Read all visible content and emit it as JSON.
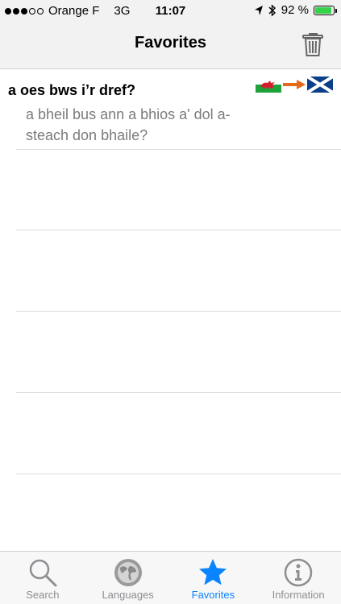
{
  "status_bar": {
    "carrier": "Orange F",
    "network": "3G",
    "time": "11:07",
    "battery_percent": "92 %",
    "battery_level": 0.92,
    "signal_bars": 3
  },
  "nav": {
    "title": "Favorites"
  },
  "favorites": [
    {
      "phrase": "a oes bws i’r dref?",
      "translation": "a bheil bus ann a bhios a' dol a-steach don bhaile?",
      "from_flag": "wales-flag-icon",
      "to_flag": "scotland-flag-icon"
    }
  ],
  "tabs": [
    {
      "label": "Search",
      "icon": "search-icon"
    },
    {
      "label": "Languages",
      "icon": "globe-icon"
    },
    {
      "label": "Favorites",
      "icon": "star-icon"
    },
    {
      "label": "Information",
      "icon": "info-icon"
    }
  ],
  "colors": {
    "accent": "#0a84ff",
    "battery": "#35d24b",
    "arrow": "#e36a16"
  }
}
